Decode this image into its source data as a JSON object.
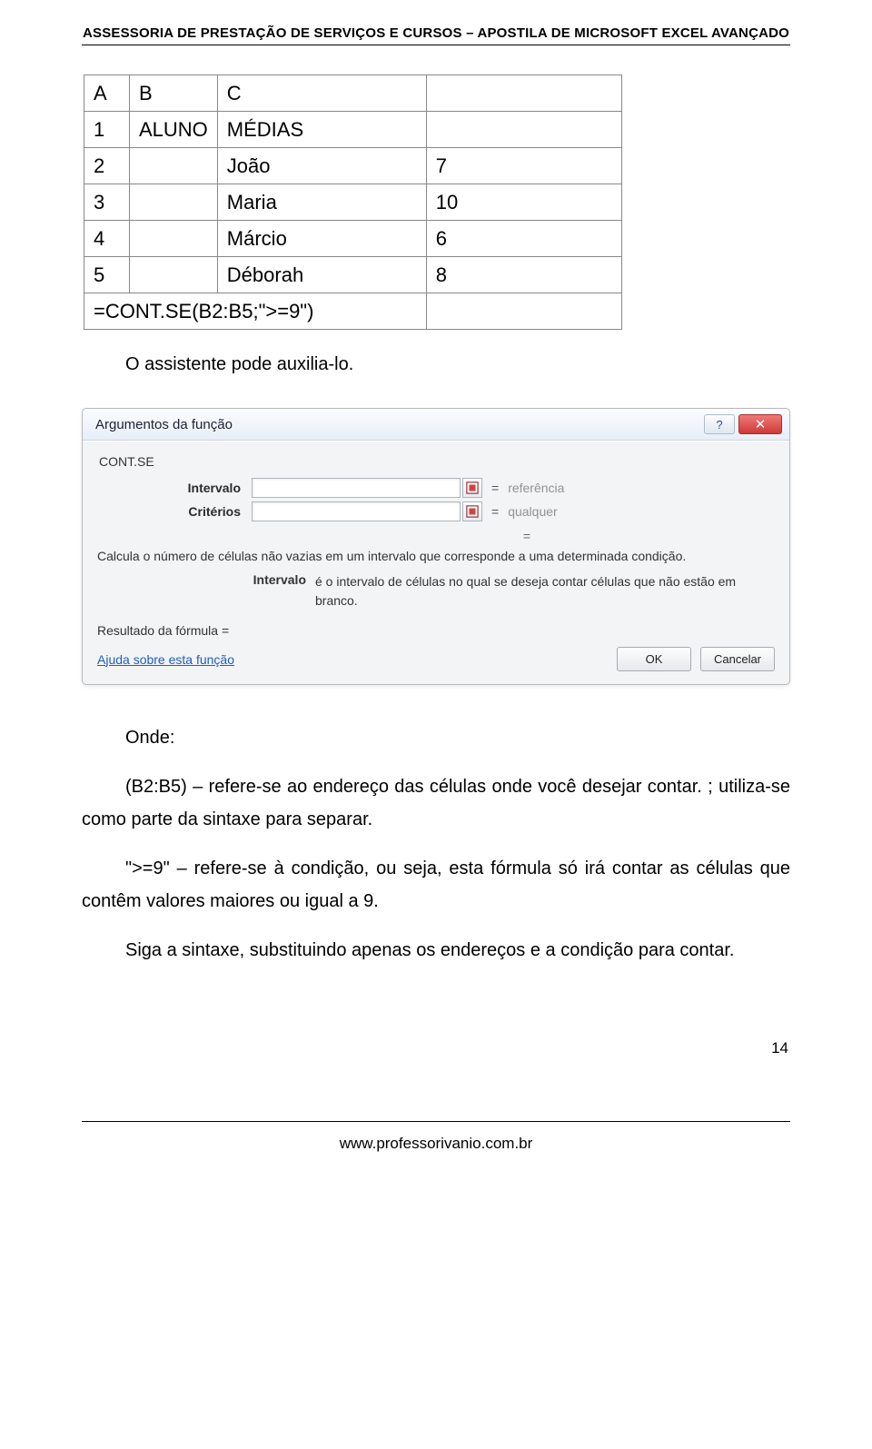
{
  "header": {
    "title": "ASSESSORIA DE PRESTAÇÃO DE SERVIÇOS E CURSOS – APOSTILA DE MICROSOFT EXCEL AVANÇADO"
  },
  "excel_table": {
    "cols": [
      "A",
      "B",
      "C",
      ""
    ],
    "rows": [
      {
        "n": "1",
        "b": "ALUNO",
        "c": "MÉDIAS",
        "d": ""
      },
      {
        "n": "2",
        "b": "",
        "c": "João",
        "d": "7"
      },
      {
        "n": "3",
        "b": "",
        "c": "Maria",
        "d": "10"
      },
      {
        "n": "4",
        "b": "",
        "c": "Márcio",
        "d": "6"
      },
      {
        "n": "5",
        "b": "",
        "c": "Déborah",
        "d": "8"
      }
    ],
    "formula_row": {
      "text": "=CONT.SE(B2:B5;\">=9\")",
      "d": ""
    }
  },
  "paragraphs": {
    "p1": "O assistente pode auxilia-lo.",
    "p2_label": "Onde:",
    "p3": "(B2:B5) – refere-se ao endereço das células onde você desejar contar. ; utiliza-se como parte da sintaxe para separar.",
    "p4": "\">=9\" – refere-se à condição, ou seja, esta fórmula só irá contar as células que contêm valores maiores ou igual a 9.",
    "p5": "Siga a sintaxe, substituindo apenas os endereços e a condição para contar."
  },
  "dialog": {
    "title": "Argumentos da função",
    "help_glyph": "?",
    "close_glyph": "✕",
    "func_name": "CONT.SE",
    "arg1_label": "Intervalo",
    "arg1_value": "",
    "arg1_hint": "referência",
    "arg2_label": "Critérios",
    "arg2_value": "",
    "arg2_hint": "qualquer",
    "eq_only": "=",
    "description": "Calcula o número de células não vazias em um intervalo que corresponde a uma determinada condição.",
    "sub_label": "Intervalo",
    "sub_text": "é o intervalo de células no qual se deseja contar células que não estão em branco.",
    "result_label": "Resultado da fórmula =",
    "help_link": "Ajuda sobre esta função",
    "ok_label": "OK",
    "cancel_label": "Cancelar"
  },
  "footer": {
    "page_number": "14",
    "url": "www.professorivanio.com.br"
  }
}
